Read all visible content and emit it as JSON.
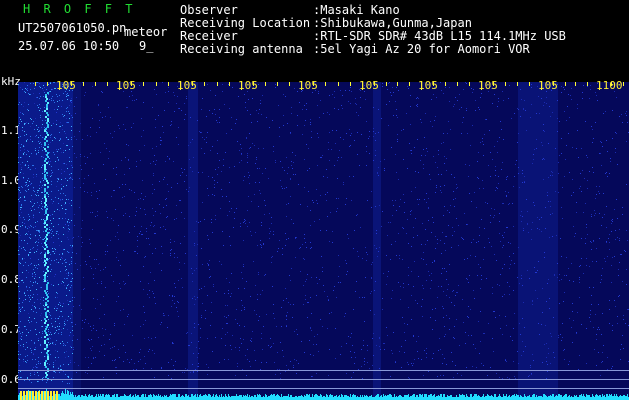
{
  "header": {
    "app_name": "H R O F F T",
    "filename": "UT2507061050.pn",
    "mode": "meteor",
    "datetime": "25.07.06 10:50",
    "counter": "9_",
    "info": [
      {
        "label": "Observer",
        "value": ":Masaki Kano"
      },
      {
        "label": "Receiving Location",
        "value": ":Shibukawa,Gunma,Japan"
      },
      {
        "label": "Receiver",
        "value": ":RTL-SDR SDR# 43dB L15 114.1MHz USB"
      },
      {
        "label": "Receiving antenna",
        "value": ":5el Yagi Az 20 for Aomori VOR"
      }
    ]
  },
  "y_axis": {
    "unit": "kHz",
    "ticks": [
      "1.1",
      "1.0",
      "0.9",
      "0.8",
      "0.7",
      "0.6"
    ]
  },
  "x_axis": {
    "ticks": [
      "105",
      "105",
      "105",
      "105",
      "105",
      "105",
      "105",
      "105",
      "105",
      "1100"
    ]
  },
  "colors": {
    "background": "#000000",
    "spectrogram_base": "#05085a",
    "tick_yellow": "#ffff33",
    "text_white": "#ffffff",
    "title_green": "#22dd33",
    "signal_cyan": "#22ddff"
  }
}
